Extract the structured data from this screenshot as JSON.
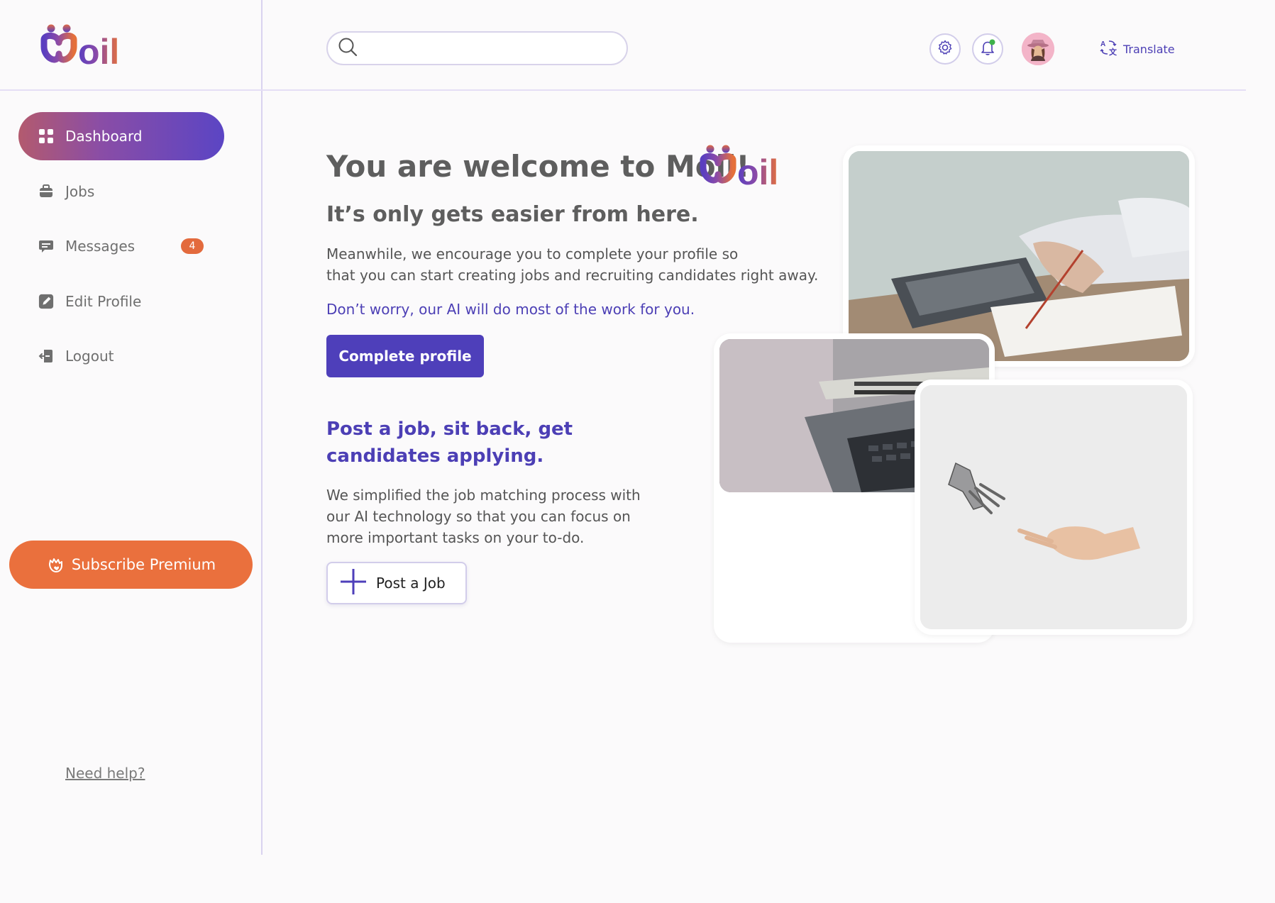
{
  "brand": {
    "logo_text": "moil"
  },
  "sidebar": {
    "items": [
      {
        "label": "Dashboard",
        "icon": "dashboard-icon",
        "active": true
      },
      {
        "label": "Jobs",
        "icon": "briefcase-icon",
        "active": false
      },
      {
        "label": "Messages",
        "icon": "message-icon",
        "active": false,
        "badge": "4"
      },
      {
        "label": "Edit Profile",
        "icon": "edit-icon",
        "active": false
      },
      {
        "label": "Logout",
        "icon": "logout-icon",
        "active": false
      }
    ],
    "subscribe_label": "Subscribe Premium",
    "help_label": "Need help?"
  },
  "header": {
    "search": {
      "placeholder": "",
      "value": ""
    },
    "translate_label": "Translate",
    "notification_dot": true
  },
  "main": {
    "welcome_title": "You are welcome to Moil!",
    "subtitle": "It’s only gets easier from here.",
    "paragraph_line1": "Meanwhile, we encourage you to complete your profile so",
    "paragraph_line2": "that you can start creating jobs and recruiting candidates right away.",
    "ai_note": "Don’t worry, our AI will do most of the work for you.",
    "complete_button": "Complete profile",
    "post_title": "Post a job, sit back, get candidates applying.",
    "post_paragraph": "We simplified the job matching process with our AI technology so that you can focus on more important tasks on your to-do.",
    "post_button": "Post a Job"
  },
  "colors": {
    "primary": "#4e3fba",
    "accent_orange": "#ea703d",
    "badge": "#e36a3d",
    "gradient_start": "#b35a6e",
    "gradient_end": "#5b45c4"
  }
}
